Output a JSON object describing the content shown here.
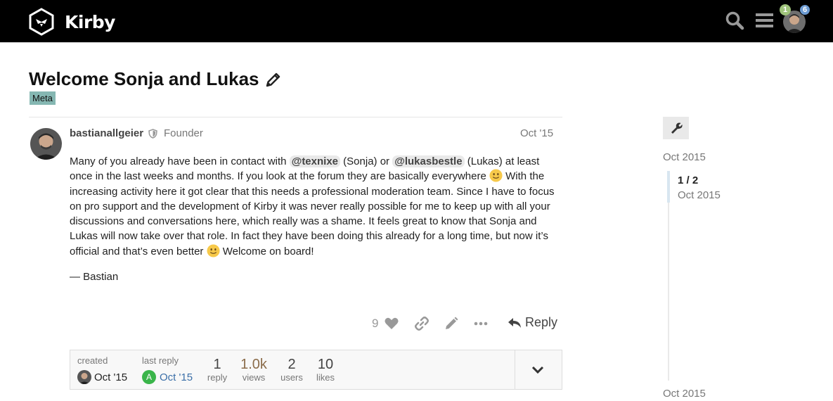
{
  "header": {
    "site_name": "Kirby",
    "notifications": {
      "green": "1",
      "blue": "6"
    }
  },
  "topic": {
    "title": "Welcome Sonja and Lukas",
    "category": "Meta",
    "category_color": "#85b7b2"
  },
  "post": {
    "username": "bastianallgeier",
    "user_title": "Founder",
    "date": "Oct '15",
    "body": [
      {
        "t": "text",
        "v": "Many of you already have been in contact with "
      },
      {
        "t": "mention",
        "v": "@texnixe"
      },
      {
        "t": "text",
        "v": " (Sonja) or "
      },
      {
        "t": "mention",
        "v": "@lukasbestle"
      },
      {
        "t": "text",
        "v": " (Lukas) at least once in the last weeks and months. If you look at the forum they are basically everywhere "
      },
      {
        "t": "emoji",
        "v": "slightly_smiling_face"
      },
      {
        "t": "text",
        "v": " With the increasing activity here it got clear that this needs a professional moderation team. Since I have to focus on pro support and the development of Kirby it was never really possible for me to keep up with all your discussions and conversations here, which really was a shame. It feels great to know that Sonja and Lukas will now take over that role. In fact they have been doing this already for a long time, but now it’s official and that’s even better "
      },
      {
        "t": "emoji",
        "v": "slightly_smiling_face"
      },
      {
        "t": "text",
        "v": " Welcome on board!"
      }
    ],
    "signature": "— Bastian",
    "like_count": "9",
    "reply_label": "Reply"
  },
  "topic_map": {
    "created_label": "created",
    "created_date": "Oct '15",
    "last_reply_label": "last reply",
    "last_reply_avatar_letter": "A",
    "last_reply_date": "Oct '15",
    "stats": [
      {
        "value": "1",
        "label": "reply"
      },
      {
        "value": "1.0k",
        "label": "views"
      },
      {
        "value": "2",
        "label": "users"
      },
      {
        "value": "10",
        "label": "likes"
      }
    ]
  },
  "timeline": {
    "start_date": "Oct 2015",
    "position": "1 / 2",
    "position_date": "Oct 2015",
    "end_date": "Oct 2015"
  },
  "colors": {
    "header_bg": "#000000",
    "views_highlight": "#8b6c4a",
    "last_reply_link": "#3b6fa8",
    "avatar_green": "#3ab54a"
  }
}
